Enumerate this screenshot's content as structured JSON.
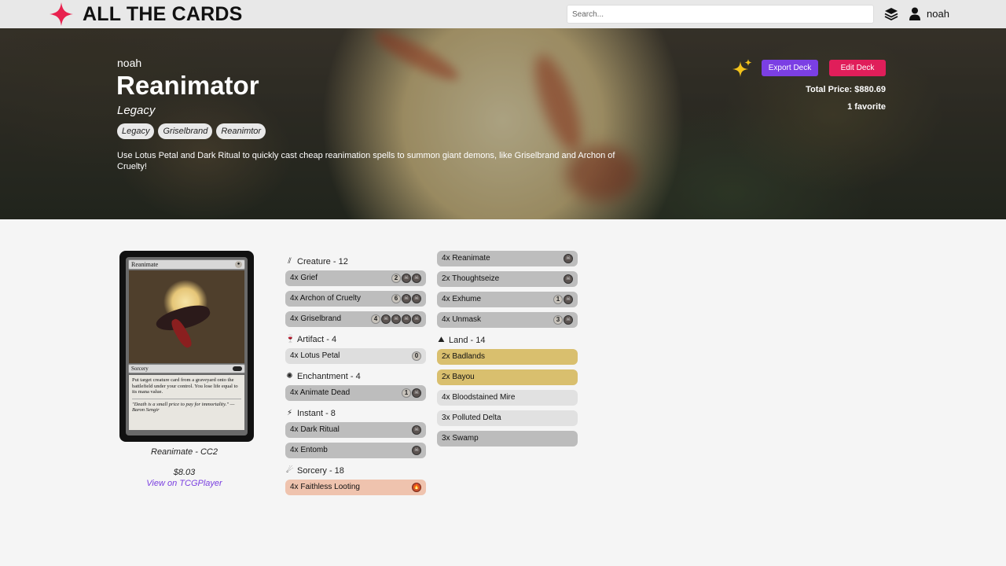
{
  "header": {
    "brand": "ALL THE CARDS",
    "brand_color": "#e8224f",
    "search_placeholder": "Search...",
    "user": "noah"
  },
  "deck": {
    "owner": "noah",
    "title": "Reanimator",
    "format": "Legacy",
    "tags": [
      "Legacy",
      "Griselbrand",
      "Reanimtor"
    ],
    "description": "Use Lotus Petal and Dark Ritual to quickly cast cheap reanimation spells to summon giant demons, like Griselbrand and Archon of Cruelty!",
    "export_label": "Export Deck",
    "edit_label": "Edit Deck",
    "total_price": "Total Price: $880.69",
    "favorites": "1 favorite",
    "colors": {
      "export": "#7b3fe4",
      "edit": "#e01e5a"
    }
  },
  "preview": {
    "card_name": "Reanimate",
    "card_type": "Sorcery",
    "card_cost": "B",
    "card_text": "Put target creature card from a graveyard onto the battlefield under your control. You lose life equal to its mana value.",
    "card_flavor": "\"Death is a small price to pay for immortality.\" —Baron Sengir",
    "caption": "Reanimate - CC2",
    "price": "$8.03",
    "link": "View on TCGPlayer"
  },
  "sections_col1": [
    {
      "name": "Creature - 12",
      "icon": "creature-icon",
      "glyph": "⫽",
      "cards": [
        {
          "label": "4x Grief",
          "color": "black",
          "mana": [
            "2",
            "B",
            "B"
          ]
        },
        {
          "label": "4x Archon of Cruelty",
          "color": "black",
          "mana": [
            "6",
            "B",
            "B"
          ]
        },
        {
          "label": "4x Griselbrand",
          "color": "black",
          "mana": [
            "4",
            "B",
            "B",
            "B",
            "B"
          ]
        }
      ]
    },
    {
      "name": "Artifact - 4",
      "icon": "artifact-icon",
      "glyph": "🍷",
      "cards": [
        {
          "label": "4x Lotus Petal",
          "color": "colorless",
          "mana": [
            "0"
          ]
        }
      ]
    },
    {
      "name": "Enchantment - 4",
      "icon": "enchantment-icon",
      "glyph": "✺",
      "cards": [
        {
          "label": "4x Animate Dead",
          "color": "black",
          "mana": [
            "1",
            "B"
          ]
        }
      ]
    },
    {
      "name": "Instant - 8",
      "icon": "instant-icon",
      "glyph": "⚡",
      "cards": [
        {
          "label": "4x Dark Ritual",
          "color": "black",
          "mana": [
            "B"
          ]
        },
        {
          "label": "4x Entomb",
          "color": "black",
          "mana": [
            "B"
          ]
        }
      ]
    },
    {
      "name": "Sorcery - 18",
      "icon": "sorcery-icon",
      "glyph": "☄",
      "cards": [
        {
          "label": "4x Faithless Looting",
          "color": "red",
          "mana": [
            "R"
          ]
        }
      ]
    }
  ],
  "sections_col2": [
    {
      "name": "",
      "icon": "",
      "glyph": "",
      "cards": [
        {
          "label": "4x Reanimate",
          "color": "black",
          "mana": [
            "B"
          ]
        },
        {
          "label": "2x Thoughtseize",
          "color": "black",
          "mana": [
            "B"
          ]
        },
        {
          "label": "4x Exhume",
          "color": "black",
          "mana": [
            "1",
            "B"
          ]
        },
        {
          "label": "4x Unmask",
          "color": "black",
          "mana": [
            "3",
            "B"
          ]
        }
      ]
    },
    {
      "name": "Land - 14",
      "icon": "land-icon",
      "glyph": "⛰",
      "cards": [
        {
          "label": "2x Badlands",
          "color": "gold",
          "mana": []
        },
        {
          "label": "2x Bayou",
          "color": "gold",
          "mana": []
        },
        {
          "label": "4x Bloodstained Mire",
          "color": "landc",
          "mana": []
        },
        {
          "label": "3x Polluted Delta",
          "color": "landc",
          "mana": []
        },
        {
          "label": "3x Swamp",
          "color": "swamp",
          "mana": []
        }
      ]
    }
  ]
}
